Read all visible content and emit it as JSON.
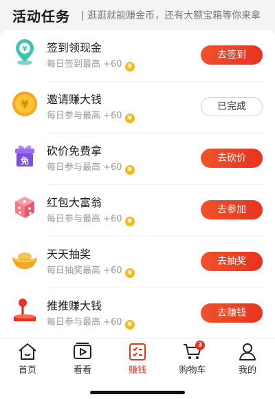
{
  "header": {
    "title": "活动任务",
    "subtitle": "| 逛逛就能赚金币，还有大额宝箱等你来拿"
  },
  "tasks": [
    {
      "icon": "location-pin-icon",
      "title": "签到领现金",
      "subtitle": "每日签到最高 +60",
      "button": "去签到",
      "done": false
    },
    {
      "icon": "coin-icon",
      "title": "邀请赚大钱",
      "subtitle": "每日参与最高 +60",
      "button": "已完成",
      "done": true
    },
    {
      "icon": "gift-box-icon",
      "title": "砍价免费拿",
      "subtitle": "每日参与最高 +60",
      "button": "去砍价",
      "done": false,
      "icon_text": "免"
    },
    {
      "icon": "dice-icon",
      "title": "红包大富翁",
      "subtitle": "每日参与最高 +60",
      "button": "去参加",
      "done": false
    },
    {
      "icon": "gold-ingot-icon",
      "title": "天天抽奖",
      "subtitle": "每日抽奖最高 +60",
      "button": "去抽奖",
      "done": false
    },
    {
      "icon": "joystick-icon",
      "title": "推推赚大钱",
      "subtitle": "每日参与最高 +60",
      "button": "去赚钱",
      "done": false
    }
  ],
  "coin_symbol": "¥",
  "tabbar": {
    "items": [
      {
        "label": "首页",
        "icon": "home-icon",
        "active": false
      },
      {
        "label": "看看",
        "icon": "video-play-icon",
        "active": false
      },
      {
        "label": "赚钱",
        "icon": "task-list-icon",
        "active": true
      },
      {
        "label": "购物车",
        "icon": "shopping-cart-icon",
        "active": false,
        "badge": "3"
      },
      {
        "label": "我的",
        "icon": "user-icon",
        "active": false
      }
    ]
  },
  "colors": {
    "accent": "#e8331f",
    "coin": "#f6b91a"
  }
}
